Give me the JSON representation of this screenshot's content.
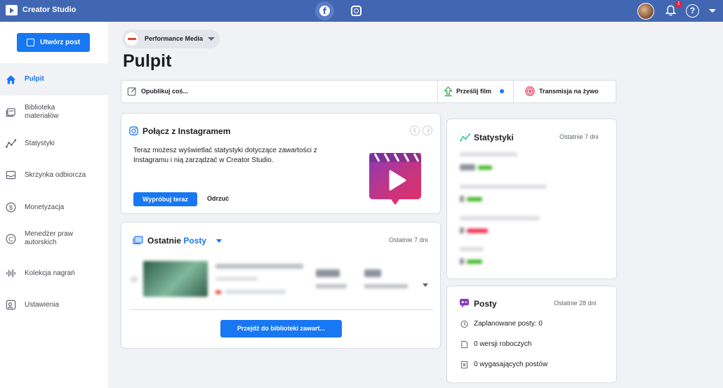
{
  "topbar": {
    "app_title": "Creator Studio",
    "notification_count": "1",
    "help_label": "?"
  },
  "sidebar": {
    "create_label": "Utwórz post",
    "items": [
      {
        "label": "Pulpit",
        "icon": "home-icon"
      },
      {
        "label": "Biblioteka materiałów",
        "icon": "library-icon"
      },
      {
        "label": "Statystyki",
        "icon": "insights-icon"
      },
      {
        "label": "Skrzynka odbiorcza",
        "icon": "inbox-icon"
      },
      {
        "label": "Monetyzacja",
        "icon": "dollar-icon"
      },
      {
        "label": "Menedżer praw autorskich",
        "icon": "copyright-icon"
      },
      {
        "label": "Kolekcja nagrań",
        "icon": "sound-icon"
      },
      {
        "label": "Ustawienia",
        "icon": "settings-icon"
      }
    ]
  },
  "page": {
    "selector_name": "Performance Media",
    "title": "Pulpit"
  },
  "publish_bar": {
    "publish": "Opublikuj coś...",
    "upload": "Prześlij film",
    "live": "Transmisja na żywo"
  },
  "instagram_card": {
    "title": "Połącz z Instagramem",
    "description": "Teraz możesz wyświetlać statystyki dotyczące zawartości z Instagramu i nią zarządzać w Creator Studio.",
    "try_label": "Wypróbuj teraz",
    "dismiss_label": "Odrzuć"
  },
  "recent_card": {
    "title_prefix": "Ostatnie",
    "title_dropdown": "Posty",
    "period": "Ostatnie 7 dni",
    "button_label": "Przejdź do biblioteki zawart..."
  },
  "stats_card": {
    "title": "Statystyki",
    "period": "Ostatnie 7 dni"
  },
  "posts_card": {
    "title": "Posty",
    "period": "Ostatnie 28 dni",
    "rows": [
      {
        "label": "Zaplanowane posty: 0",
        "icon": "clock-icon"
      },
      {
        "label": "0 wersji roboczych",
        "icon": "draft-icon"
      },
      {
        "label": "0 wygasających postów",
        "icon": "expiring-icon"
      }
    ]
  },
  "colors": {
    "topbar": "#4267b2",
    "accent": "#1877f2",
    "background": "#f0f2f5"
  }
}
